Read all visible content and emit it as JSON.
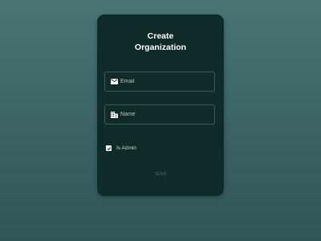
{
  "form": {
    "title_line1": "Create",
    "title_line2": "Organization",
    "email": {
      "placeholder": "Email",
      "value": "",
      "icon": "mail-icon"
    },
    "name": {
      "placeholder": "Name",
      "value": "",
      "icon": "building-icon"
    },
    "is_admin": {
      "label": "Is Admin",
      "checked": true
    },
    "send_label": "SEND"
  },
  "colors": {
    "background": "#3e6767",
    "card": "#0e2b2a",
    "field_border": "#3d5a58",
    "title_text": "#ffffff",
    "send_text": "#4d6a68"
  }
}
